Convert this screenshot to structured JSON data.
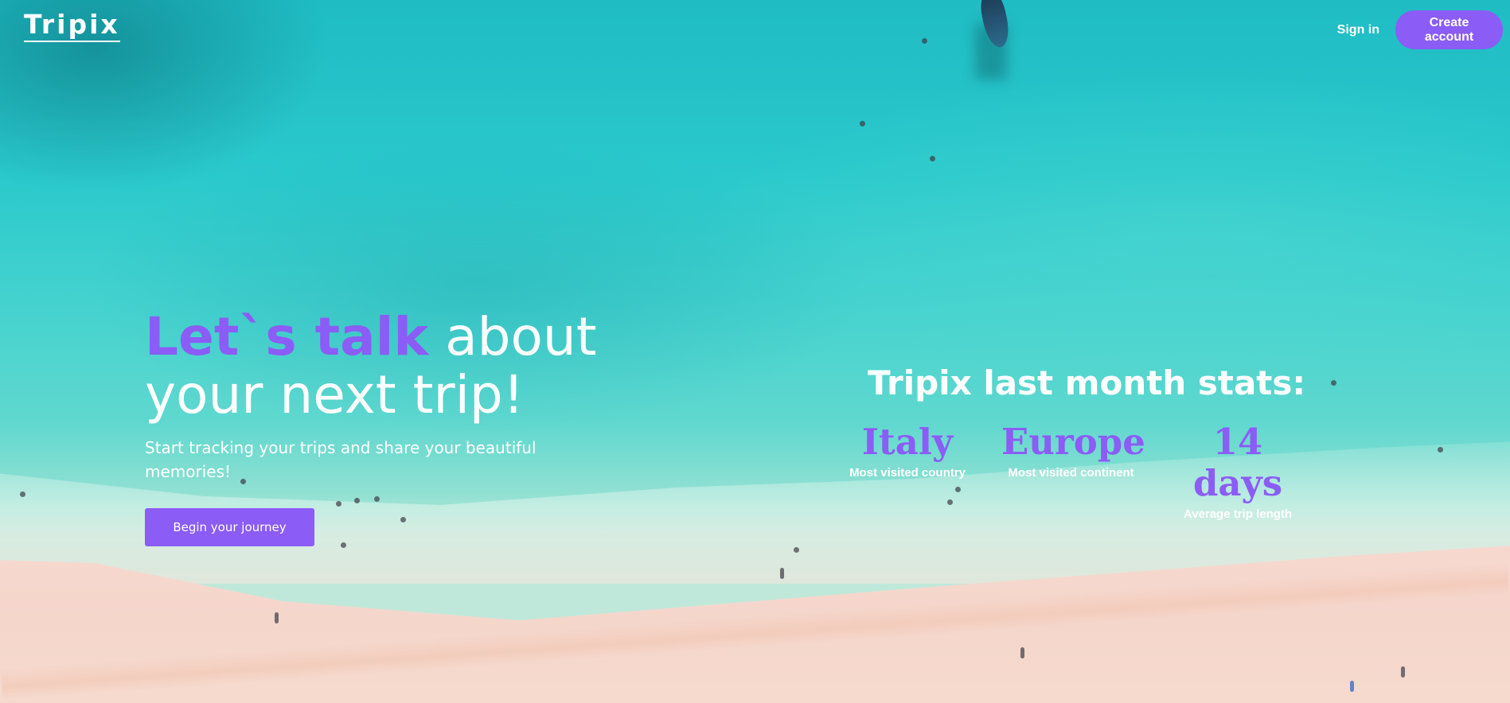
{
  "header": {
    "logo": "Tripix",
    "sign_in": "Sign in",
    "create_account": "Create account"
  },
  "hero": {
    "title_accent": "Let`s talk",
    "title_rest_line1": " about",
    "title_line2": "your next trip!",
    "subtitle": "Start tracking your trips and share your beautiful memories!",
    "cta_label": "Begin your journey"
  },
  "stats": {
    "title": "Tripix last month stats:",
    "items": [
      {
        "value": "Italy",
        "label": "Most visited country"
      },
      {
        "value": "Europe",
        "label": "Most visited continent"
      },
      {
        "value": "14 days",
        "label": "Average trip length"
      }
    ]
  },
  "colors": {
    "accent": "#8b5cf6",
    "text": "#ffffff",
    "water": "#2ac9cc",
    "sand": "#f5d6cb"
  }
}
